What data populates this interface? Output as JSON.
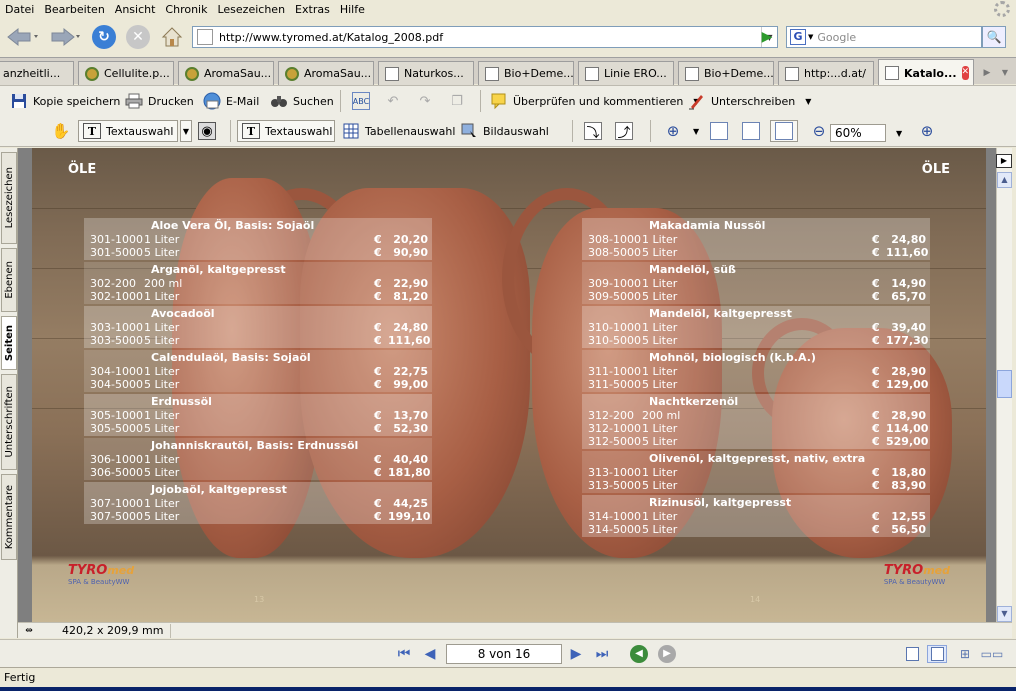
{
  "menu": [
    "Datei",
    "Bearbeiten",
    "Ansicht",
    "Chronik",
    "Lesezeichen",
    "Extras",
    "Hilfe"
  ],
  "nav": {
    "url": "http://www.tyromed.at/Katalog_2008.pdf",
    "search_placeholder": "Google"
  },
  "tabs": [
    {
      "label": "anzheitli...",
      "icon": "page"
    },
    {
      "label": "Cellulite.p...",
      "icon": "leaf"
    },
    {
      "label": "AromaSau...",
      "icon": "leaf"
    },
    {
      "label": "AromaSau...",
      "icon": "leaf"
    },
    {
      "label": "Naturkos...",
      "icon": "page"
    },
    {
      "label": "Bio+Deme...",
      "icon": "page"
    },
    {
      "label": "Linie ERO...",
      "icon": "page"
    },
    {
      "label": "Bio+Deme...",
      "icon": "page"
    },
    {
      "label": "http:...d.at/",
      "icon": "page"
    },
    {
      "label": "Katalo...",
      "icon": "page",
      "active": true
    }
  ],
  "toolbar1": {
    "save_copy": "Kopie speichern",
    "print": "Drucken",
    "email": "E-Mail",
    "search": "Suchen",
    "review": "Überprüfen und kommentieren",
    "sign": "Unterschreiben"
  },
  "toolbar2": {
    "text_select_tool": "Textauswahl",
    "text_select": "Textauswahl",
    "table_select": "Tabellenauswahl",
    "image_select": "Bildauswahl",
    "zoom": "60%"
  },
  "sidepanel": [
    "Lesezeichen",
    "Ebenen",
    "Seiten",
    "Unterschriften",
    "Kommentare"
  ],
  "document": {
    "left_heading": "ÖLE",
    "right_heading": "ÖLE",
    "currency": "€",
    "left_page_number": "13",
    "right_page_number": "14",
    "logo_text": "TYRO",
    "logo_suffix": "med",
    "logo_sub": "SPA & BeautyWW",
    "left_products": [
      {
        "name": "Aloe Vera Öl, Basis: Sojaöl",
        "rows": [
          {
            "code": "301-1000",
            "qty": "1 Liter",
            "price": "20,20"
          },
          {
            "code": "301-5000",
            "qty": "5 Liter",
            "price": "90,90"
          }
        ]
      },
      {
        "name": "Arganöl, kaltgepresst",
        "rows": [
          {
            "code": "302-200",
            "qty": "200 ml",
            "price": "22,90"
          },
          {
            "code": "302-1000",
            "qty": "1 Liter",
            "price": "81,20"
          }
        ]
      },
      {
        "name": "Avocadoöl",
        "rows": [
          {
            "code": "303-1000",
            "qty": "1 Liter",
            "price": "24,80"
          },
          {
            "code": "303-5000",
            "qty": "5 Liter",
            "price": "111,60"
          }
        ]
      },
      {
        "name": "Calendulaöl, Basis: Sojaöl",
        "rows": [
          {
            "code": "304-1000",
            "qty": "1 Liter",
            "price": "22,75"
          },
          {
            "code": "304-5000",
            "qty": "5 Liter",
            "price": "99,00"
          }
        ]
      },
      {
        "name": "Erdnussöl",
        "rows": [
          {
            "code": "305-1000",
            "qty": "1 Liter",
            "price": "13,70"
          },
          {
            "code": "305-5000",
            "qty": "5 Liter",
            "price": "52,30"
          }
        ]
      },
      {
        "name": "Johanniskrautöl, Basis: Erdnussöl",
        "rows": [
          {
            "code": "306-1000",
            "qty": "1 Liter",
            "price": "40,40"
          },
          {
            "code": "306-5000",
            "qty": "5 Liter",
            "price": "181,80"
          }
        ]
      },
      {
        "name": "Jojobaöl, kaltgepresst",
        "rows": [
          {
            "code": "307-1000",
            "qty": "1 Liter",
            "price": "44,25"
          },
          {
            "code": "307-5000",
            "qty": "5 Liter",
            "price": "199,10"
          }
        ]
      }
    ],
    "right_products": [
      {
        "name": "Makadamia Nussöl",
        "rows": [
          {
            "code": "308-1000",
            "qty": "1 Liter",
            "price": "24,80"
          },
          {
            "code": "308-5000",
            "qty": "5 Liter",
            "price": "111,60"
          }
        ]
      },
      {
        "name": "Mandelöl, süß",
        "rows": [
          {
            "code": "309-1000",
            "qty": "1 Liter",
            "price": "14,90"
          },
          {
            "code": "309-5000",
            "qty": "5 Liter",
            "price": "65,70"
          }
        ]
      },
      {
        "name": "Mandelöl, kaltgepresst",
        "rows": [
          {
            "code": "310-1000",
            "qty": "1 Liter",
            "price": "39,40"
          },
          {
            "code": "310-5000",
            "qty": "5 Liter",
            "price": "177,30"
          }
        ]
      },
      {
        "name": "Mohnöl, biologisch (k.b.A.)",
        "rows": [
          {
            "code": "311-1000",
            "qty": "1 Liter",
            "price": "28,90"
          },
          {
            "code": "311-5000",
            "qty": "5 Liter",
            "price": "129,00"
          }
        ]
      },
      {
        "name": "Nachtkerzenöl",
        "rows": [
          {
            "code": "312-200",
            "qty": "200 ml",
            "price": "28,90"
          },
          {
            "code": "312-1000",
            "qty": "1 Liter",
            "price": "114,00"
          },
          {
            "code": "312-5000",
            "qty": "5 Liter",
            "price": "529,00"
          }
        ]
      },
      {
        "name": "Olivenöl, kaltgepresst, nativ, extra",
        "rows": [
          {
            "code": "313-1000",
            "qty": "1 Liter",
            "price": "18,80"
          },
          {
            "code": "313-5000",
            "qty": "5 Liter",
            "price": "83,90"
          }
        ]
      },
      {
        "name": "Rizinusöl, kaltgepresst",
        "rows": [
          {
            "code": "314-1000",
            "qty": "1 Liter",
            "price": "12,55"
          },
          {
            "code": "314-5000",
            "qty": "5 Liter",
            "price": "56,50"
          }
        ]
      }
    ]
  },
  "doc_status": {
    "dimensions": "420,2 x 209,9 mm"
  },
  "pagebar": {
    "counter": "8 von 16"
  },
  "status": "Fertig",
  "colors": {
    "accent": "#3e63b8",
    "close_tab": "#e04141",
    "go_arrow": "#2d9a2d"
  }
}
